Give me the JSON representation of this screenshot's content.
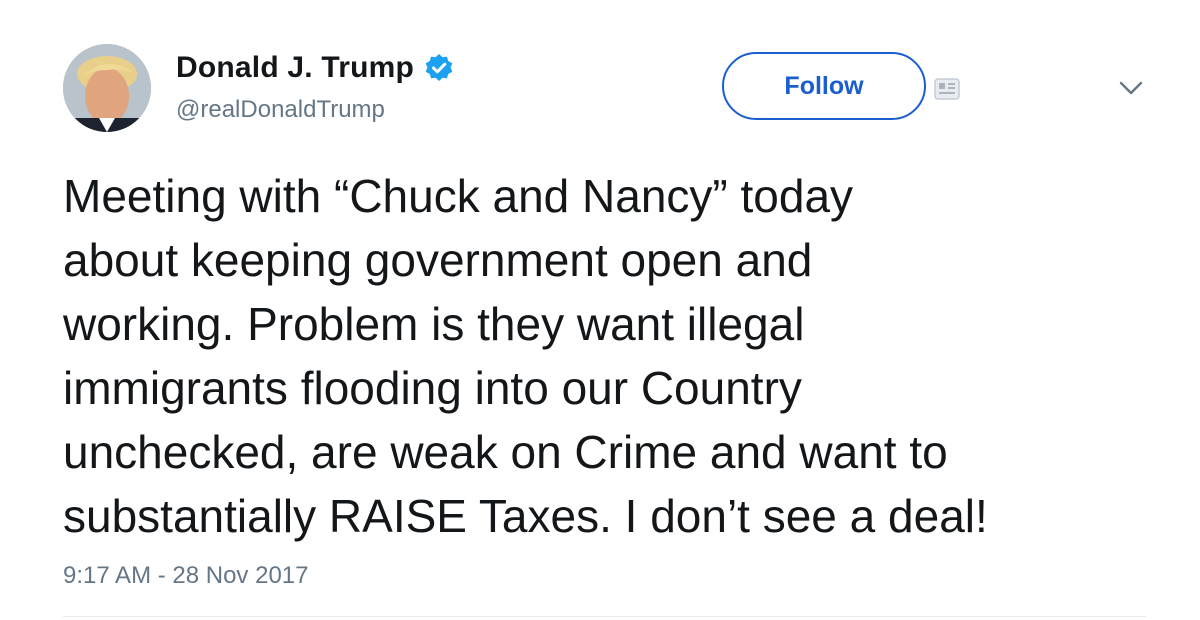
{
  "user": {
    "display_name": "Donald J. Trump",
    "handle": "@realDonaldTrump",
    "verified": true
  },
  "actions": {
    "follow_label": "Follow"
  },
  "tweet": {
    "lines": [
      "Meeting with “Chuck and Nancy” today",
      "about keeping government open and",
      "working. Problem is they want illegal",
      "immigrants flooding into our Country",
      "unchecked, are weak on Crime and want to",
      "substantially RAISE Taxes. I don’t see a deal!"
    ],
    "timestamp": "9:17 AM - 28 Nov 2017"
  },
  "icons": {
    "verified": "verified-badge-icon",
    "follow_extra": "follow-notification-icon",
    "menu": "chevron-down-icon"
  },
  "colors": {
    "accent": "#1b5fcf",
    "verified": "#1da1f2",
    "text": "#14171a",
    "muted": "#657786"
  }
}
